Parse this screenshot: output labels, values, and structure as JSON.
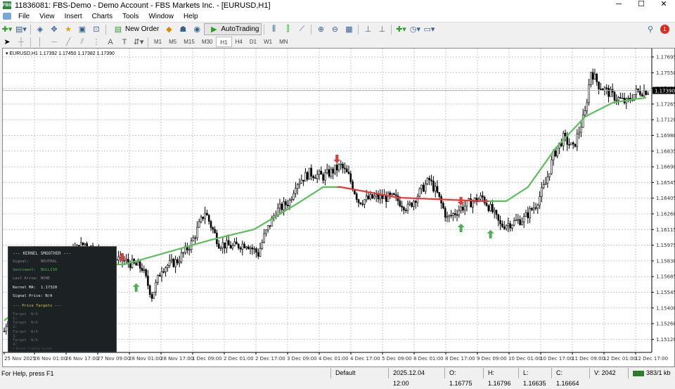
{
  "window": {
    "title": "11836081: FBS-Demo - Demo Account - FBS Markets Inc. - [EURUSD,H1]",
    "logo": "FBS",
    "minimize": "─",
    "maximize": "☐",
    "close": "✕"
  },
  "menu": [
    "File",
    "View",
    "Insert",
    "Charts",
    "Tools",
    "Window",
    "Help"
  ],
  "toolbar": {
    "new_order": "New Order",
    "autotrading": "AutoTrading",
    "notification_count": "1"
  },
  "timeframes": [
    "M1",
    "M5",
    "M15",
    "M30",
    "H1",
    "H4",
    "D1",
    "W1",
    "MN"
  ],
  "active_timeframe": "H1",
  "chart_header": "EURUSD,H1  1.17392 1.17450 1.17382 1.17390",
  "current_price": "1.17390",
  "panel": {
    "title": "--- KERNEL SMOOTHER ---",
    "rows": [
      {
        "k": "Signal:",
        "v": "NEUTRAL"
      },
      {
        "k": "Sentiment:",
        "v": "BULLISH"
      },
      {
        "k": "Last Arrow:",
        "v": "NONE"
      },
      {
        "k": "Kernel MA:",
        "v": "1.17320"
      },
      {
        "k": "Signal Price:",
        "v": "N/A"
      }
    ],
    "targets_title": "--- Price Targets ---",
    "targets": [
      {
        "k": "Target 1:",
        "v": "N/A"
      },
      {
        "k": "Target 2:",
        "v": "N/A"
      },
      {
        "k": "Target 3:",
        "v": "N/A"
      },
      {
        "k": "Target 4:",
        "v": "N/A"
      }
    ],
    "footer": "© Kernel Trading System"
  },
  "status": {
    "help": "For Help, press F1",
    "profile": "Default",
    "time": "2025.12.04 12:00",
    "open": "O: 1.16775",
    "high": "H: 1.16796",
    "low": "L: 1.16635",
    "close": "C: 1.16664",
    "volume": "V: 2042",
    "traffic": "383/1 kb"
  },
  "colors": {
    "bull_ma": "#5cbf5c",
    "bear_ma": "#e53935",
    "up_arrow": "#4caf50",
    "down_arrow": "#e53935"
  },
  "chart_data": {
    "type": "line",
    "symbol": "EURUSD",
    "timeframe": "H1",
    "x_unit": "hours since 25 Nov 2025",
    "price_keypoints": [
      [
        0,
        1.15195
      ],
      [
        4,
        1.15451
      ],
      [
        12,
        1.1558
      ],
      [
        20,
        1.15772
      ],
      [
        30,
        1.15868
      ],
      [
        41,
        1.15996
      ],
      [
        52,
        1.15868
      ],
      [
        61,
        1.15836
      ],
      [
        70,
        1.15772
      ],
      [
        75,
        1.15516
      ],
      [
        80,
        1.15772
      ],
      [
        88,
        1.15836
      ],
      [
        95,
        1.15996
      ],
      [
        102,
        1.16285
      ],
      [
        105,
        1.16157
      ],
      [
        109,
        1.15996
      ],
      [
        116,
        1.15964
      ],
      [
        123,
        1.15996
      ],
      [
        129,
        1.159
      ],
      [
        132,
        1.1606
      ],
      [
        138,
        1.16285
      ],
      [
        145,
        1.16381
      ],
      [
        148,
        1.16541
      ],
      [
        155,
        1.16637
      ],
      [
        162,
        1.16605
      ],
      [
        168,
        1.16669
      ],
      [
        171,
        1.16701
      ],
      [
        175,
        1.16605
      ],
      [
        180,
        1.16381
      ],
      [
        188,
        1.16413
      ],
      [
        198,
        1.16413
      ],
      [
        205,
        1.16317
      ],
      [
        213,
        1.16509
      ],
      [
        216,
        1.16573
      ],
      [
        220,
        1.16445
      ],
      [
        225,
        1.16221
      ],
      [
        232,
        1.16317
      ],
      [
        238,
        1.16381
      ],
      [
        243,
        1.16413
      ],
      [
        248,
        1.16285
      ],
      [
        252,
        1.16157
      ],
      [
        259,
        1.16189
      ],
      [
        264,
        1.16221
      ],
      [
        270,
        1.16349
      ],
      [
        275,
        1.16541
      ],
      [
        279,
        1.16798
      ],
      [
        284,
        1.16958
      ],
      [
        289,
        1.16862
      ],
      [
        295,
        1.17182
      ],
      [
        298,
        1.17567
      ],
      [
        302,
        1.17439
      ],
      [
        309,
        1.17342
      ],
      [
        316,
        1.17278
      ],
      [
        321,
        1.17374
      ],
      [
        327,
        1.1739
      ]
    ],
    "ma_keypoints": [
      [
        0,
        1.15291
      ],
      [
        34,
        1.15804
      ],
      [
        61,
        1.15804
      ],
      [
        80,
        1.159
      ],
      [
        105,
        1.16028
      ],
      [
        127,
        1.16124
      ],
      [
        148,
        1.16349
      ],
      [
        162,
        1.16509
      ],
      [
        171,
        1.16509
      ],
      [
        200,
        1.16413
      ],
      [
        243,
        1.16381
      ],
      [
        255,
        1.16381
      ],
      [
        266,
        1.16509
      ],
      [
        280,
        1.16862
      ],
      [
        295,
        1.1715
      ],
      [
        309,
        1.17278
      ],
      [
        320,
        1.1731
      ],
      [
        326,
        1.17323
      ]
    ],
    "ma_bear_range": [
      169,
      245
    ],
    "arrows": [
      {
        "type": "down",
        "x": 60,
        "price": 1.15868
      },
      {
        "type": "up",
        "x": 67,
        "price": 1.15593
      },
      {
        "type": "down",
        "x": 169,
        "price": 1.16766
      },
      {
        "type": "down",
        "x": 232,
        "price": 1.16381
      },
      {
        "type": "up",
        "x": 232,
        "price": 1.16137
      },
      {
        "type": "up",
        "x": 247,
        "price": 1.1608
      }
    ],
    "ylim": [
      1.1505,
      1.1778
    ],
    "y_ticks": [
      "1.17695",
      "1.17550",
      "1.17410",
      "1.17265",
      "1.17120",
      "1.16980",
      "1.16835",
      "1.16690",
      "1.16545",
      "1.16405",
      "1.16260",
      "1.16115",
      "1.15975",
      "1.15830",
      "1.15685",
      "1.15545",
      "1.15400",
      "1.15260",
      "1.15120"
    ],
    "x_ticks": [
      "25 Nov 2025",
      "26 Nov 01:00",
      "26 Nov 17:00",
      "27 Nov 09:00",
      "28 Nov 01:00",
      "28 Nov 17:00",
      "1 Dec 09:00",
      "2 Dec 01:00",
      "2 Dec 17:00",
      "3 Dec 09:00",
      "4 Dec 01:00",
      "4 Dec 17:00",
      "5 Dec 09:00",
      "8 Dec 01:00",
      "8 Dec 17:00",
      "9 Dec 09:00",
      "10 Dec 01:00",
      "10 Dec 17:00",
      "11 Dec 09:00",
      "12 Dec 01:00",
      "12 Dec 17:00"
    ]
  }
}
